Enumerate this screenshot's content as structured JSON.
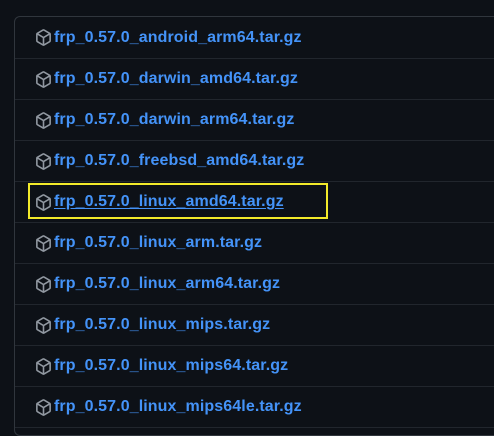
{
  "assets": {
    "items": [
      {
        "name": "frp_0.57.0_android_arm64.tar.gz",
        "icon": "package-icon",
        "highlighted": false
      },
      {
        "name": "frp_0.57.0_darwin_amd64.tar.gz",
        "icon": "package-icon",
        "highlighted": false
      },
      {
        "name": "frp_0.57.0_darwin_arm64.tar.gz",
        "icon": "package-icon",
        "highlighted": false
      },
      {
        "name": "frp_0.57.0_freebsd_amd64.tar.gz",
        "icon": "package-icon",
        "highlighted": false
      },
      {
        "name": "frp_0.57.0_linux_amd64.tar.gz",
        "icon": "package-icon",
        "highlighted": true
      },
      {
        "name": "frp_0.57.0_linux_arm.tar.gz",
        "icon": "package-icon",
        "highlighted": false
      },
      {
        "name": "frp_0.57.0_linux_arm64.tar.gz",
        "icon": "package-icon",
        "highlighted": false
      },
      {
        "name": "frp_0.57.0_linux_mips.tar.gz",
        "icon": "package-icon",
        "highlighted": false
      },
      {
        "name": "frp_0.57.0_linux_mips64.tar.gz",
        "icon": "package-icon",
        "highlighted": false
      },
      {
        "name": "frp_0.57.0_linux_mips64le.tar.gz",
        "icon": "package-icon",
        "highlighted": false
      }
    ]
  },
  "colors": {
    "background": "#0d1117",
    "link": "#4493f8",
    "border": "#30363d",
    "highlight": "#f2ea2a"
  }
}
